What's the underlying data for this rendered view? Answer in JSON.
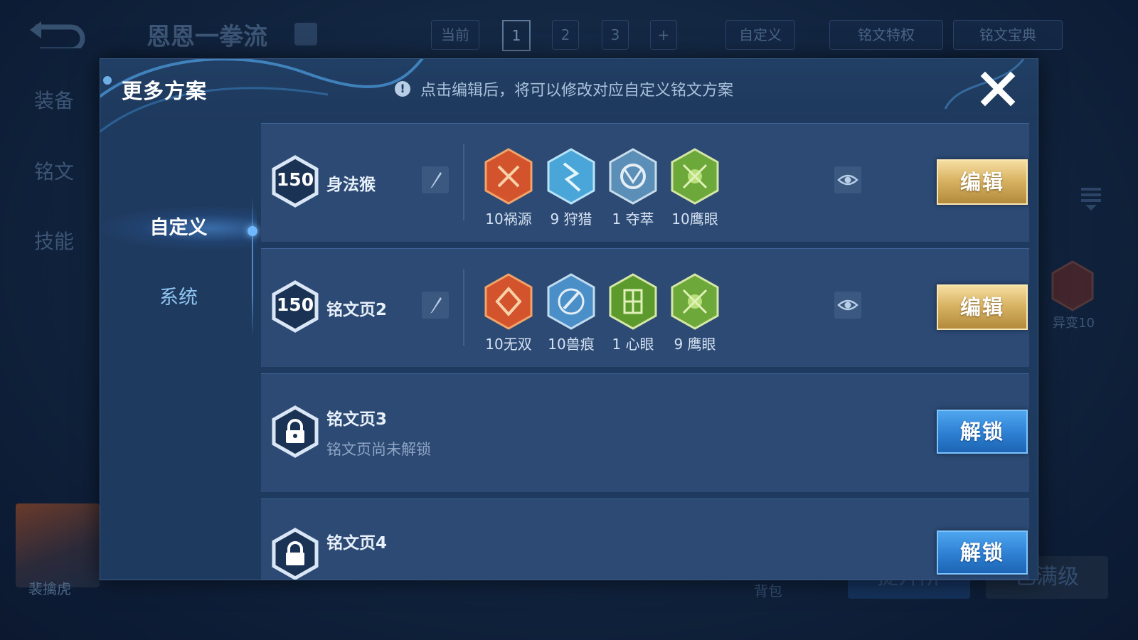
{
  "background": {
    "title": "恩恩一拳流",
    "top_bar": {
      "current_label": "当前",
      "pages": [
        "1",
        "2",
        "3"
      ],
      "add_label": "+",
      "custom_label": "自定义",
      "privilege_label": "铭文特权",
      "guide_label": "铭文宝典"
    },
    "side_tabs": [
      "装备",
      "铭文",
      "技能"
    ],
    "right_rune_label": "异变10",
    "hero_name": "裴擒虎",
    "bag_label": "背包",
    "bottom_buttons": [
      "提升阶",
      "已满级"
    ]
  },
  "modal": {
    "title": "更多方案",
    "hint": "点击编辑后，将可以修改对应自定义铭文方案",
    "nav": [
      {
        "label": "自定义",
        "active": true
      },
      {
        "label": "系统",
        "active": false
      }
    ],
    "pages": [
      {
        "level": "150",
        "name": "身法猴",
        "runes": [
          {
            "label": "10祸源",
            "icon": "red-rune-icon",
            "color": "#d2532c"
          },
          {
            "label": "9 狩猎",
            "icon": "blue-rune-icon",
            "color": "#4aa6d8"
          },
          {
            "label": "1 夺萃",
            "icon": "blue-rune-icon",
            "color": "#5b8fb8"
          },
          {
            "label": "10鹰眼",
            "icon": "green-rune-icon",
            "color": "#6da83a"
          }
        ],
        "action_label": "编辑"
      },
      {
        "level": "150",
        "name": "铭文页2",
        "runes": [
          {
            "label": "10无双",
            "icon": "red-rune-icon",
            "color": "#d2532c"
          },
          {
            "label": "10兽痕",
            "icon": "blue-rune-icon",
            "color": "#4a8fc8"
          },
          {
            "label": "1 心眼",
            "icon": "green-rune-icon",
            "color": "#6da83a"
          },
          {
            "label": "9 鹰眼",
            "icon": "green-rune-icon",
            "color": "#6da83a"
          }
        ],
        "action_label": "编辑"
      },
      {
        "name": "铭文页3",
        "subtitle": "铭文页尚未解锁",
        "action_label": "解锁"
      },
      {
        "name": "铭文页4",
        "action_label": "解锁"
      }
    ]
  }
}
